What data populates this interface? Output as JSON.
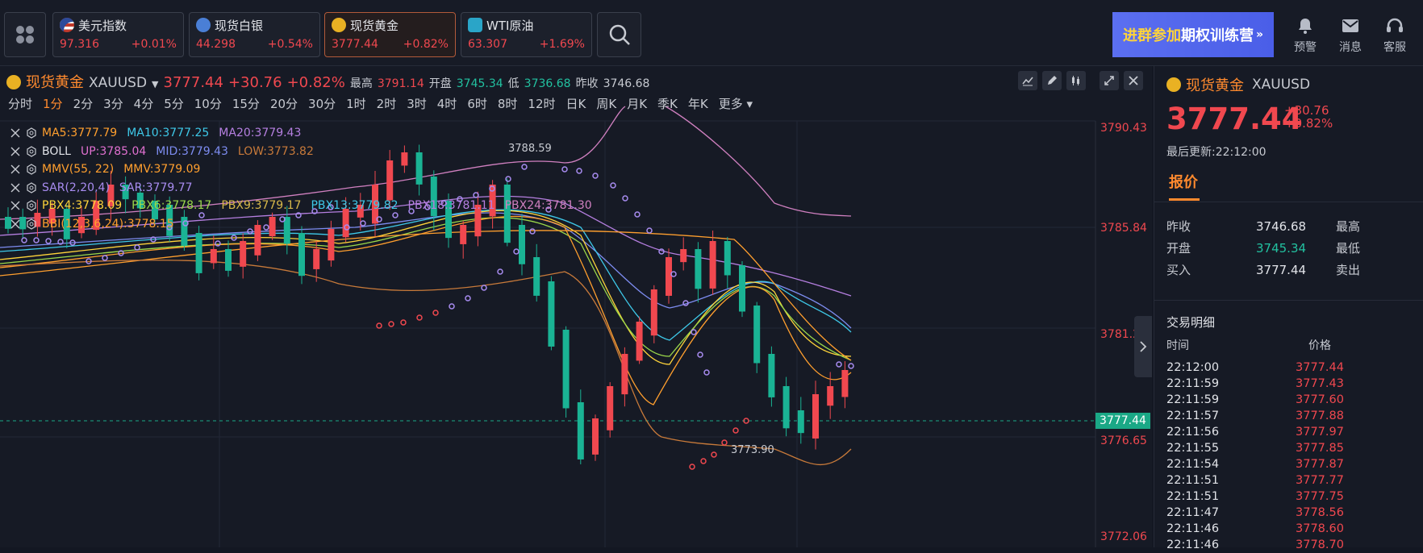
{
  "topbar": {
    "tickers": [
      {
        "name": "美元指数",
        "price": "97.316",
        "change": "+0.01%",
        "icon_color": "#c0392b"
      },
      {
        "name": "现货白银",
        "price": "44.298",
        "change": "+0.54%",
        "icon_color": "#4a7fd6"
      },
      {
        "name": "现货黄金",
        "price": "3777.44",
        "change": "+0.82%",
        "icon_color": "#e9b123"
      },
      {
        "name": "WTI原油",
        "price": "63.307",
        "change": "+1.69%",
        "icon_color": "#2aa5c8"
      }
    ],
    "promo": {
      "part1": "进群参加",
      "part2": "期权训练营",
      "arrow": "»"
    },
    "actions": [
      {
        "label": "预警",
        "icon": "bell-icon"
      },
      {
        "label": "消息",
        "icon": "mail-icon"
      },
      {
        "label": "客服",
        "icon": "headset-icon"
      }
    ]
  },
  "chart": {
    "symbol_name": "现货黄金",
    "symbol_code": "XAUUSD",
    "price": "3777.44",
    "change": "+30.76",
    "change_pct": "+0.82%",
    "high_label": "最高",
    "high": "3791.14",
    "open_label": "开盘",
    "open": "3745.34",
    "low_label": "低",
    "low": "3736.68",
    "prev_label": "昨收",
    "prev": "3746.68",
    "periods": [
      "分时",
      "1分",
      "2分",
      "3分",
      "4分",
      "5分",
      "10分",
      "15分",
      "20分",
      "30分",
      "1时",
      "2时",
      "3时",
      "4时",
      "6时",
      "8时",
      "12时",
      "日K",
      "周K",
      "月K",
      "季K",
      "年K",
      "更多"
    ],
    "active_period": "1分",
    "indicators": [
      {
        "parts": [
          {
            "t": "MA5:3777.79",
            "c": "#ff9f2e"
          },
          {
            "t": "MA10:3777.25",
            "c": "#3ec8e8"
          },
          {
            "t": "MA20:3779.43",
            "c": "#b57fe0"
          }
        ]
      },
      {
        "parts": [
          {
            "t": "BOLL",
            "c": "#e1e3e8"
          },
          {
            "t": "UP:3785.04",
            "c": "#e070d0"
          },
          {
            "t": "MID:3779.43",
            "c": "#7d8cf0"
          },
          {
            "t": "LOW:3773.82",
            "c": "#c87a3a"
          }
        ]
      },
      {
        "parts": [
          {
            "t": "MMV(55, 22)",
            "c": "#ff9f2e"
          },
          {
            "t": "MMV:3779.09",
            "c": "#ff9f2e"
          }
        ]
      },
      {
        "parts": [
          {
            "t": "SAR(2,20,4)",
            "c": "#a88cf0"
          },
          {
            "t": "SAR:3779.77",
            "c": "#a88cf0"
          }
        ]
      },
      {
        "parts": [
          {
            "t": "PBX4:3778.09",
            "c": "#ffd43a"
          },
          {
            "t": "PBX6:3778.17",
            "c": "#9bd84a"
          },
          {
            "t": "PBX9:3779.17",
            "c": "#d8b84a"
          },
          {
            "t": "PBX13:3779.82",
            "c": "#3ec8e8"
          },
          {
            "t": "PBX18:3781.11",
            "c": "#b57fe0"
          },
          {
            "t": "PBX24:3781.30",
            "c": "#d080c0"
          }
        ]
      },
      {
        "parts": [
          {
            "t": "BBI(12,3,6,24):3778.15",
            "c": "#ff9f2e"
          }
        ]
      }
    ],
    "axis_labels": [
      "3790.43",
      "3785.84",
      "3781.24",
      "3776.65",
      "3772.06"
    ],
    "current_price_tag": "3777.44",
    "annotations": [
      "3788.59",
      "3773.90"
    ]
  },
  "side": {
    "symbol_name": "现货黄金",
    "symbol_code": "XAUUSD",
    "price": "3777.44",
    "change": "+30.76",
    "change_pct": "+0.82%",
    "updated": "最后更新:22:12:00",
    "tab": "报价",
    "quotes": [
      {
        "label": "昨收",
        "value": "3746.68",
        "value_color": "#e1e3e8",
        "right": "最高"
      },
      {
        "label": "开盘",
        "value": "3745.34",
        "value_color": "#22c1a0",
        "right": "最低"
      },
      {
        "label": "买入",
        "value": "3777.44",
        "value_color": "#e1e3e8",
        "right": "卖出"
      }
    ],
    "trade_title": "交易明细",
    "trade_head_time": "时间",
    "trade_head_price": "价格",
    "trades": [
      {
        "time": "22:12:00",
        "price": "3777.44"
      },
      {
        "time": "22:11:59",
        "price": "3777.43"
      },
      {
        "time": "22:11:59",
        "price": "3777.60"
      },
      {
        "time": "22:11:57",
        "price": "3777.88"
      },
      {
        "time": "22:11:56",
        "price": "3777.97"
      },
      {
        "time": "22:11:55",
        "price": "3777.85"
      },
      {
        "time": "22:11:54",
        "price": "3777.87"
      },
      {
        "time": "22:11:51",
        "price": "3777.77"
      },
      {
        "time": "22:11:51",
        "price": "3777.75"
      },
      {
        "time": "22:11:47",
        "price": "3778.56"
      },
      {
        "time": "22:11:46",
        "price": "3778.60"
      },
      {
        "time": "22:11:46",
        "price": "3778.70"
      }
    ]
  }
}
